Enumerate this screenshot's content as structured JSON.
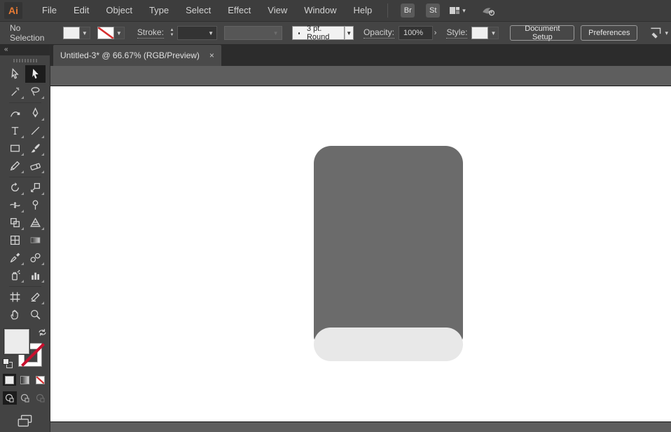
{
  "menu_bar": {
    "logo_text": "Ai",
    "items": [
      "File",
      "Edit",
      "Object",
      "Type",
      "Select",
      "Effect",
      "View",
      "Window",
      "Help"
    ],
    "bridge_button": "Br",
    "stock_button": "St"
  },
  "control_bar": {
    "selection_status": "No Selection",
    "stroke_label": "Stroke:",
    "brush_name": "3 pt. Round",
    "opacity_label": "Opacity:",
    "opacity_value": "100%",
    "style_label": "Style:",
    "document_setup_button": "Document Setup",
    "preferences_button": "Preferences"
  },
  "tab_bar": {
    "collapse_glyph": "«",
    "active_tab": {
      "title": "Untitled-3* @ 66.67% (RGB/Preview)",
      "close_glyph": "×"
    }
  },
  "toolbar": {
    "active_tool": "selection-tool",
    "tools": [
      "direct-selection-tool",
      "selection-tool",
      "magic-wand-tool",
      "lasso-tool",
      "curvature-tool",
      "pen-tool",
      "type-tool",
      "line-segment-tool",
      "rectangle-tool",
      "paintbrush-tool",
      "shaper-tool",
      "eraser-tool",
      "rotate-tool",
      "scale-tool",
      "width-tool",
      "puppet-warp-tool",
      "shape-builder-tool",
      "perspective-grid-tool",
      "mesh-tool",
      "gradient-tool",
      "eyedropper-tool",
      "blend-tool",
      "symbol-sprayer-tool",
      "column-graph-tool",
      "artboard-tool",
      "slice-tool",
      "hand-tool",
      "zoom-tool"
    ],
    "fill_stroke": {
      "fill": "light-gray",
      "stroke": "none"
    },
    "color_buttons": [
      "color",
      "gradient",
      "none"
    ],
    "drawing_modes": [
      "draw-normal",
      "draw-behind",
      "draw-inside"
    ]
  },
  "canvas": {
    "artboard_color": "#ffffff",
    "pasteboard_color": "#5e5e5e",
    "shape": {
      "type": "rounded-rectangle-with-light-band",
      "body_color": "#6b6b6b",
      "band_color": "#e8e8e8"
    }
  },
  "colors": {
    "menubar_bg": "#3d3d3d",
    "panel_bg": "#444444",
    "tabbar_bg": "#2c2c2c",
    "tab_bg": "#4a4a4a",
    "accent_orange": "#e77b34",
    "none_red": "#c8102e",
    "text_light": "#d2d2d2"
  }
}
